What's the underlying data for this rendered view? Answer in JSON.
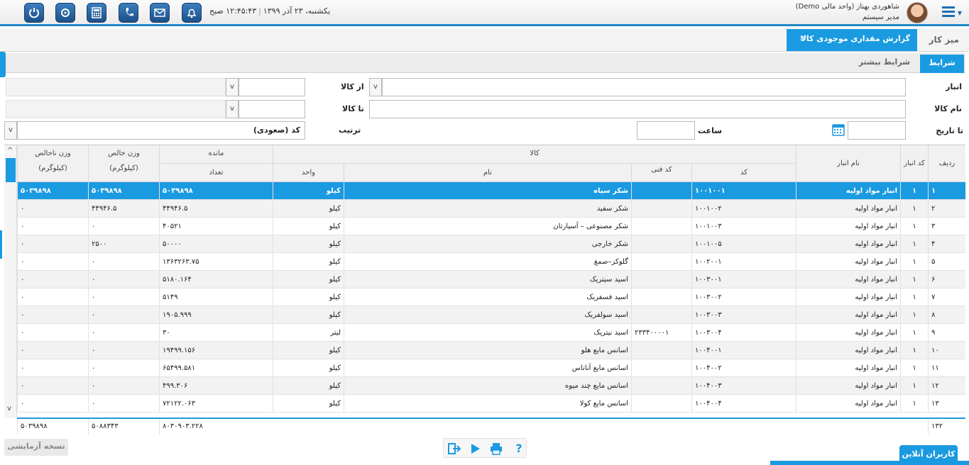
{
  "topbar": {
    "datetime_date": "یکشنبه، ۲۳ آذر ۱۳۹۹",
    "datetime_time": "۱۲:۴۵:۴۳ صبح",
    "user_name": "شاهوردی بهناز (واحد مالی Demo)",
    "user_role": "مدیر سیستم",
    "accent_color": "#1e88c7",
    "icons": [
      "power-icon",
      "settings-icon",
      "calculator-icon",
      "phone-icon",
      "mail-icon",
      "bell-icon"
    ]
  },
  "tabs": {
    "desk": "میز کار",
    "report": "گزارش مقداری موجودی کالا",
    "close": "×"
  },
  "conditions": {
    "tab_conditions": "شرایط",
    "tab_more": "شرایط بیشتر",
    "warehouse_label": "انبار",
    "item_name_label": "نام کالا",
    "to_date_label": "تا تاریخ",
    "time_label": "ساعت",
    "from_item_label": "از کالا",
    "to_item_label": "تا کالا",
    "sort_label": "ترتیب",
    "sort_value": "کد (صعودی)",
    "dropdown_glyph": "v"
  },
  "grid": {
    "headers": {
      "row": "ردیف",
      "warehouse_code": "کد انبار",
      "warehouse_name": "نام انبار",
      "item_group": "کالا",
      "code": "کد",
      "tech_code": "کد فنی",
      "name": "نام",
      "unit": "واحد",
      "balance_group": "مانده",
      "quantity": "تعداد",
      "net_weight": "وزن خالص",
      "gross_weight": "وزن ناخالص",
      "kg": "(کیلوگرم)"
    },
    "rows": [
      {
        "n": "۱",
        "wc": "۱",
        "wn": "انبار مواد اولیه",
        "code": "۱۰۰۱۰۰۱",
        "tech": "",
        "name": "شکر سیاه",
        "unit": "کیلو",
        "qty": "۵۰۳۹۸۹۸",
        "net": "۵۰۳۹۸۹۸",
        "gross": "۵۰۳۹۸۹۸"
      },
      {
        "n": "۲",
        "wc": "۱",
        "wn": "انبار مواد اولیه",
        "code": "۱۰۰۱۰۰۲",
        "tech": "",
        "name": "شکر سفید",
        "unit": "کیلو",
        "qty": "۴۴۹۴۶.۵",
        "net": "۴۴۹۴۶.۵",
        "gross": "۰"
      },
      {
        "n": "۳",
        "wc": "۱",
        "wn": "انبار مواد اولیه",
        "code": "۱۰۰۱۰۰۳",
        "tech": "",
        "name": "شکر مصنوعی – آسپارتان",
        "unit": "کیلو",
        "qty": "۴۰۵۲۱",
        "net": "۰",
        "gross": "۰"
      },
      {
        "n": "۴",
        "wc": "۱",
        "wn": "انبار مواد اولیه",
        "code": "۱۰۰۱۰۰۵",
        "tech": "",
        "name": "شکر خارجی",
        "unit": "کیلو",
        "qty": "۵۰۰۰۰",
        "net": "۲۵۰۰",
        "gross": "۰"
      },
      {
        "n": "۵",
        "wc": "۱",
        "wn": "انبار مواد اولیه",
        "code": "۱۰۰۲۰۰۱",
        "tech": "",
        "name": "گلوکز–صمغ",
        "unit": "کیلو",
        "qty": "۱۳۶۳۲۶۳.۷۵",
        "net": "۰",
        "gross": "۰"
      },
      {
        "n": "۶",
        "wc": "۱",
        "wn": "انبار مواد اولیه",
        "code": "۱۰۰۳۰۰۱",
        "tech": "",
        "name": "اسید سیتریک",
        "unit": "کیلو",
        "qty": "۵۱۸۰.۱۶۴",
        "net": "۰",
        "gross": "۰"
      },
      {
        "n": "۷",
        "wc": "۱",
        "wn": "انبار مواد اولیه",
        "code": "۱۰۰۳۰۰۲",
        "tech": "",
        "name": "اسید فسفریک",
        "unit": "کیلو",
        "qty": "۵۱۴۹",
        "net": "۰",
        "gross": "۰"
      },
      {
        "n": "۸",
        "wc": "۱",
        "wn": "انبار مواد اولیه",
        "code": "۱۰۰۳۰۰۳",
        "tech": "",
        "name": "اسید سولفریک",
        "unit": "کیلو",
        "qty": "۱۹۰۵.۹۹۹",
        "net": "۰",
        "gross": "۰"
      },
      {
        "n": "۹",
        "wc": "۱",
        "wn": "انبار مواد اولیه",
        "code": "۱۰۰۳۰۰۴",
        "tech": "۲۳۳۴۰۰۰۰۱",
        "name": "اسید نیتریک",
        "unit": "لیتر",
        "qty": "۳۰",
        "net": "۰",
        "gross": "۰"
      },
      {
        "n": "۱۰",
        "wc": "۱",
        "wn": "انبار مواد اولیه",
        "code": "۱۰۰۴۰۰۱",
        "tech": "",
        "name": "اسانس مایع هلو",
        "unit": "کیلو",
        "qty": "۱۹۴۹۹.۱۵۶",
        "net": "۰",
        "gross": "۰"
      },
      {
        "n": "۱۱",
        "wc": "۱",
        "wn": "انبار مواد اولیه",
        "code": "۱۰۰۴۰۰۲",
        "tech": "",
        "name": "اسانس مایع آناناس",
        "unit": "کیلو",
        "qty": "۶۵۴۹۹.۵۸۱",
        "net": "۰",
        "gross": "۰"
      },
      {
        "n": "۱۲",
        "wc": "۱",
        "wn": "انبار مواد اولیه",
        "code": "۱۰۰۴۰۰۳",
        "tech": "",
        "name": "اسانس مایع چند میوه",
        "unit": "کیلو",
        "qty": "۴۹۹.۳۰۶",
        "net": "۰",
        "gross": "۰"
      },
      {
        "n": "۱۳",
        "wc": "۱",
        "wn": "انبار مواد اولیه",
        "code": "۱۰۰۴۰۰۴",
        "tech": "",
        "name": "اسانس مایع کولا",
        "unit": "کیلو",
        "qty": "۷۲۱۲۲.۰۶۳",
        "net": "۰",
        "gross": "۰"
      }
    ],
    "totals": {
      "count": "۱۳۲",
      "qty": "۸۰۳۰۹۰۳.۲۲۸",
      "net": "۵۰۸۸۳۴۳",
      "gross": "۵۰۳۹۸۹۸"
    }
  },
  "bottom": {
    "demo": "نسخه آزمایشی",
    "online_users": "کاربران آنلاین",
    "help": "?"
  }
}
